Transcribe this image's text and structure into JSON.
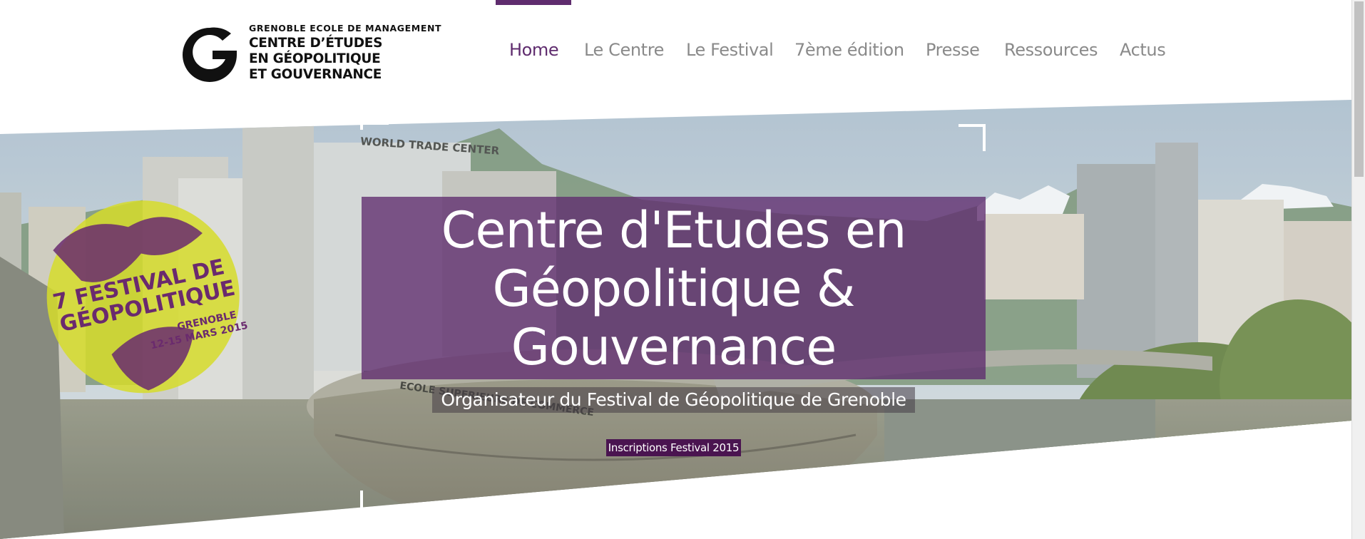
{
  "logo": {
    "top_line": "GRENOBLE ECOLE DE MANAGEMENT",
    "line1": "CENTRE D’ÉTUDES",
    "line2": "EN GÉOPOLITIQUE",
    "line3": "ET GOUVERNANCE"
  },
  "nav": {
    "items": [
      {
        "label": "Home",
        "active": true
      },
      {
        "label": "Le Centre",
        "active": false
      },
      {
        "label": "Le Festival",
        "active": false
      },
      {
        "label": "7ème édition",
        "active": false
      },
      {
        "label": "Presse",
        "active": false
      },
      {
        "label": "Ressources",
        "active": false
      },
      {
        "label": "Actus",
        "active": false
      }
    ]
  },
  "hero": {
    "title": "Centre d'Etudes en Géopolitique & Gouvernance",
    "subtitle": "Organisateur du Festival de Géopolitique de Grenoble",
    "cta": "Inscriptions Festival 2015",
    "building_signs": {
      "wtc": "WORLD TRADE CENTER",
      "school": "ECOLE SUPERIEURE DE COMMERCE"
    },
    "poster": {
      "line1": "7 FESTIVAL DE",
      "line2": "GÉOPOLITIQUE",
      "city": "GRENOBLE",
      "dates": "12-15 MARS 2015"
    }
  },
  "colors": {
    "brand_purple": "#5f2c6e",
    "cta_purple": "#4a1450",
    "nav_text": "#8a8a8a",
    "poster_yellow": "#d6dc2a"
  }
}
